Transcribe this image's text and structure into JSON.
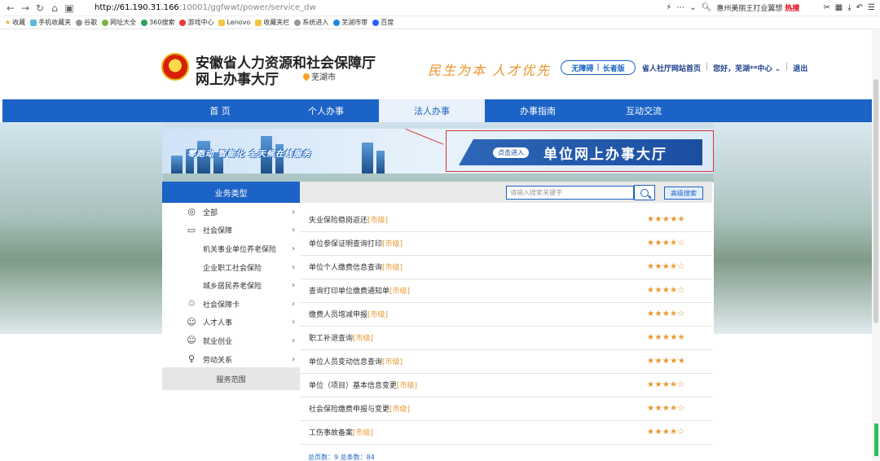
{
  "browser": {
    "url_host": "http://61.190.31.166",
    "url_path": ":10001/ggfwwt/power/service_dw",
    "search_text": "惠州美丽王打业翼想",
    "search_hot": "热搜",
    "bookmarks": [
      "收藏",
      "手机收藏夹",
      "谷歌",
      "网址大全",
      "360搜索",
      "游戏中心",
      "Lenovo",
      "收藏夹栏",
      "系统进入",
      "芜湖市审",
      "百度"
    ]
  },
  "header": {
    "org_name": "安徽省人力资源和社会保障厅",
    "hall_name": "网上办事大厅",
    "city": "芜湖市",
    "slogan": "民生为本 人才优先",
    "access_left": "无障碍",
    "access_right": "长者版",
    "portal_link": "省人社厅网站首页",
    "greeting": "您好，芜湖**中心",
    "logout": "退出"
  },
  "nav": {
    "items": [
      "首 页",
      "个人办事",
      "法人办事",
      "办事指南",
      "互动交流"
    ],
    "active_index": 2
  },
  "banner": {
    "slogan": "零跑动  智能化  全天候在线服务",
    "enter_pill": "点击进入",
    "enter_title": "单位网上办事大厅"
  },
  "sidebar": {
    "heading": "业务类型",
    "items": [
      {
        "label": "全部",
        "icon": "globe-icon",
        "sub": false
      },
      {
        "label": "社会保障",
        "icon": "card-icon",
        "sub": false
      },
      {
        "label": "机关事业单位养老保险",
        "icon": "",
        "sub": true
      },
      {
        "label": "企业职工社会保险",
        "icon": "",
        "sub": true
      },
      {
        "label": "城乡居民养老保险",
        "icon": "",
        "sub": true
      },
      {
        "label": "社会保障卡",
        "icon": "social-card-icon",
        "sub": false
      },
      {
        "label": "人才人事",
        "icon": "person-icon",
        "sub": false
      },
      {
        "label": "就业创业",
        "icon": "briefcase-icon",
        "sub": false
      },
      {
        "label": "劳动关系",
        "icon": "people-icon",
        "sub": false
      }
    ],
    "footer": "服务范围"
  },
  "search": {
    "placeholder": "请输入搜索关键字",
    "advanced_label": "高级搜索"
  },
  "services": [
    {
      "name": "失业保险稳岗返还",
      "level": "[市级]",
      "stars": "★★★★✬"
    },
    {
      "name": "单位参保证明查询打印",
      "level": "[市级]",
      "stars": "★★★✬☆"
    },
    {
      "name": "单位个人缴费信息查询",
      "level": "[市级]",
      "stars": "★★★✬☆"
    },
    {
      "name": "查询打印单位缴费通知单",
      "level": "[市级]",
      "stars": "★★★✬☆"
    },
    {
      "name": "缴费人员增减申报",
      "level": "[市级]",
      "stars": "★★★✬☆"
    },
    {
      "name": "职工补退查询",
      "level": "[市级]",
      "stars": "★★★★✬"
    },
    {
      "name": "单位人员变动信息查询",
      "level": "[市级]",
      "stars": "★★★★★"
    },
    {
      "name": "单位（项目）基本信息变更",
      "level": "[市级]",
      "stars": "★★★✬☆"
    },
    {
      "name": "社会保险缴费申报与变更",
      "level": "[市级]",
      "stars": "★★★✬☆"
    },
    {
      "name": "工伤事故备案",
      "level": "[市级]",
      "stars": "★★★✬☆"
    }
  ],
  "pager": "总页数：9  总条数：84",
  "colors": {
    "brand_blue": "#1b63c6",
    "accent_orange": "#e7952b",
    "highlight_red": "#d9343a"
  }
}
